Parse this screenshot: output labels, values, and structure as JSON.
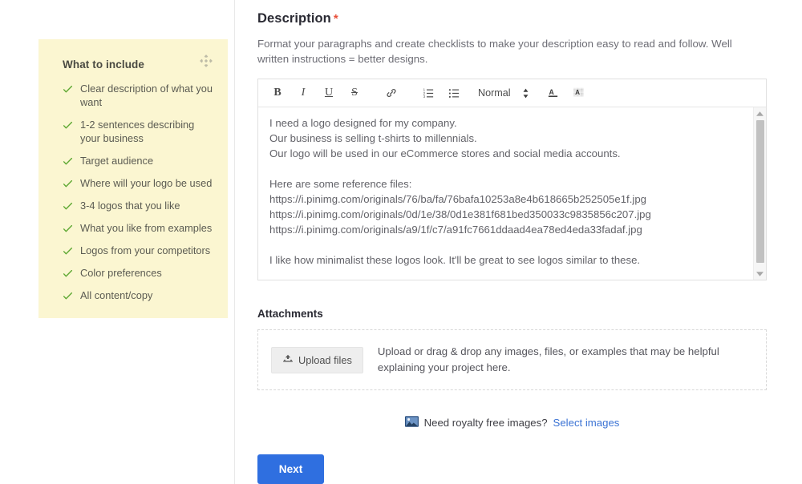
{
  "tips": {
    "title": "What to include",
    "drag_handle_icon": "move-icon",
    "check_icon": "check-icon",
    "items": [
      "Clear description of what you want",
      "1-2 sentences describing your business",
      "Target audience",
      "Where will your logo be used",
      "3-4 logos that you like",
      "What you like from examples",
      "Logos from your competitors",
      "Color preferences",
      "All content/copy"
    ],
    "background": "#fbf6d1",
    "check_color": "#5ea832"
  },
  "description": {
    "title": "Description",
    "required_mark": "*",
    "required_color": "#e8503a",
    "subtitle": "Format your paragraphs and create checklists to make your description easy to read and follow. Well written instructions = better designs."
  },
  "toolbar": {
    "bold": "B",
    "italic": "I",
    "underline": "U",
    "strikethrough": "S",
    "link_icon": "link-icon",
    "ordered_list_icon": "ordered-list-icon",
    "bullet_list_icon": "bullet-list-icon",
    "format_selected": "Normal",
    "stepper_icon": "up-down-arrows-icon",
    "text_color_icon": "text-color-icon",
    "highlight_icon": "text-highlight-icon"
  },
  "editor": {
    "lines": [
      "I need a logo designed for my company.",
      "Our business is selling t-shirts to millennials.",
      "Our logo will be used in our eCommerce stores and social media accounts.",
      "",
      "Here are some reference files:",
      "https://i.pinimg.com/originals/76/ba/fa/76bafa10253a8e4b618665b252505e1f.jpg",
      "https://i.pinimg.com/originals/0d/1e/38/0d1e381f681bed350033c9835856c207.jpg",
      "https://i.pinimg.com/originals/a9/1f/c7/a91fc7661ddaad4ea78ed4eda33fadaf.jpg",
      "",
      "I like how minimalist these logos look. It'll be great to see logos similar to these."
    ],
    "scroll_up_icon": "scroll-up-arrow-icon",
    "scroll_down_icon": "scroll-down-arrow-icon"
  },
  "attachments": {
    "title": "Attachments",
    "upload_button_label": "Upload files",
    "upload_icon": "upload-icon",
    "hint": "Upload or drag & drop any images, files, or examples that may be helpful explaining your project here."
  },
  "royalty": {
    "icon": "image-icon",
    "text": "Need royalty free images?",
    "link_label": "Select images",
    "link_color": "#3b73d4"
  },
  "footer": {
    "next_label": "Next",
    "next_color": "#2f6fe0"
  }
}
